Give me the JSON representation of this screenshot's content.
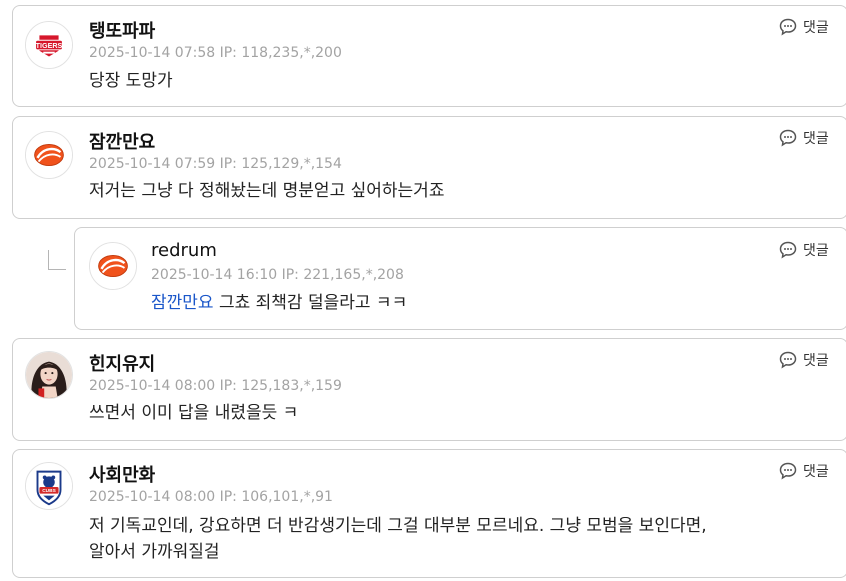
{
  "comments": [
    {
      "author": "탱또파파",
      "meta": "2025-10-14 07:58 IP: 118,235,*,200",
      "text": "당장 도망가",
      "avatar_icon": "tigers-logo-icon",
      "reply_label": "댓글"
    },
    {
      "author": "잠깐만요",
      "meta": "2025-10-14 07:59 IP: 125,129,*,154",
      "text": "저거는 그냥 다 정해놨는데 명분얻고 싶어하는거죠",
      "avatar_icon": "orange-ball-logo-icon",
      "reply_label": "댓글"
    },
    {
      "author": "redrum",
      "meta": "2025-10-14 16:10 IP: 221,165,*,208",
      "mention": "잠깐만요",
      "text": " 그쵸 죄책감 덜을라고 ㅋㅋ",
      "avatar_icon": "orange-ball-logo-icon",
      "reply_label": "댓글"
    },
    {
      "author": "힌지유지",
      "meta": "2025-10-14 08:00 IP: 125,183,*,159",
      "text": "쓰면서 이미 답을 내렸을듯 ㅋ",
      "avatar_icon": "portrait-photo-icon",
      "reply_label": "댓글"
    },
    {
      "author": "사회만화",
      "meta": "2025-10-14 08:00 IP: 106,101,*,91",
      "text_line1": "저 기독교인데, 강요하면 더 반감생기는데 그걸 대부분 모르네요. 그냥 모범을 보인다면,",
      "text_line2": "알아서 가까워질걸",
      "avatar_icon": "cubs-shield-logo-icon",
      "reply_label": "댓글"
    }
  ],
  "colors": {
    "mention": "#1a56c9",
    "meta": "#a3a3a3",
    "border": "#cfcfcf",
    "tigers_red": "#d6172b",
    "orange": "#f0521c"
  }
}
